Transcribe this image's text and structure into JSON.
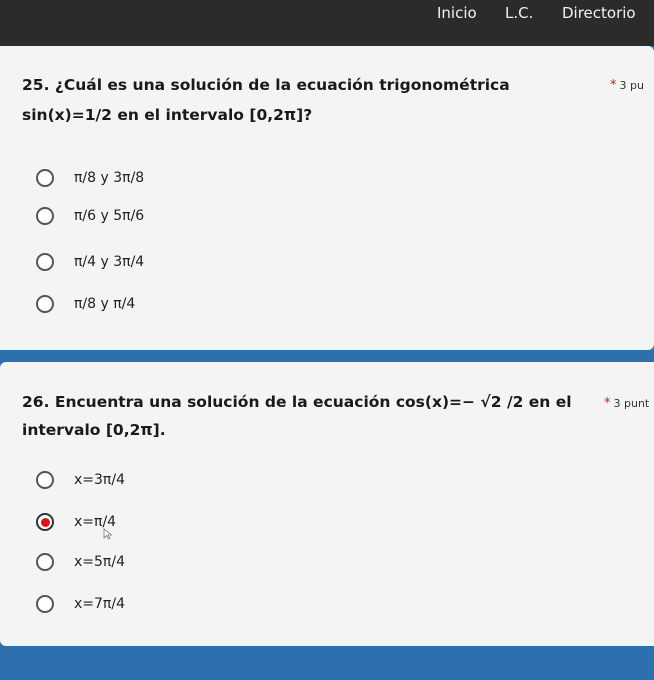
{
  "nav": {
    "items": [
      {
        "label": "Inicio"
      },
      {
        "label": "L.C."
      },
      {
        "label": "Directorio"
      }
    ]
  },
  "questions": [
    {
      "line1": "25. ¿Cuál es una solución de la ecuación trigonométrica",
      "line2": "sin(x)=1/2 en el intervalo [0,2π]?",
      "points": "3 pu",
      "options": [
        {
          "label": "π/8 y 3π/8",
          "checked": false
        },
        {
          "label": "π/6 y 5π/6",
          "checked": false
        },
        {
          "label": "π/4 y 3π/4",
          "checked": false
        },
        {
          "label": "π/8 y π/4",
          "checked": false
        }
      ]
    },
    {
      "line1": "26. Encuentra una solución de la ecuación cos(x)=− √2 /2 en el",
      "line2": "intervalo [0,2π].",
      "points": "3 punt",
      "options": [
        {
          "label": "x=3π/4",
          "checked": false
        },
        {
          "label": "x=π/4",
          "checked": true
        },
        {
          "label": "x=5π/4",
          "checked": false
        },
        {
          "label": "x=7π/4",
          "checked": false
        }
      ]
    }
  ],
  "colors": {
    "topbar": "#2b2b2b",
    "background": "#2e6fb0",
    "card": "#f4f4f4",
    "selected_radio": "#d6141e",
    "required_star": "#c02020"
  }
}
